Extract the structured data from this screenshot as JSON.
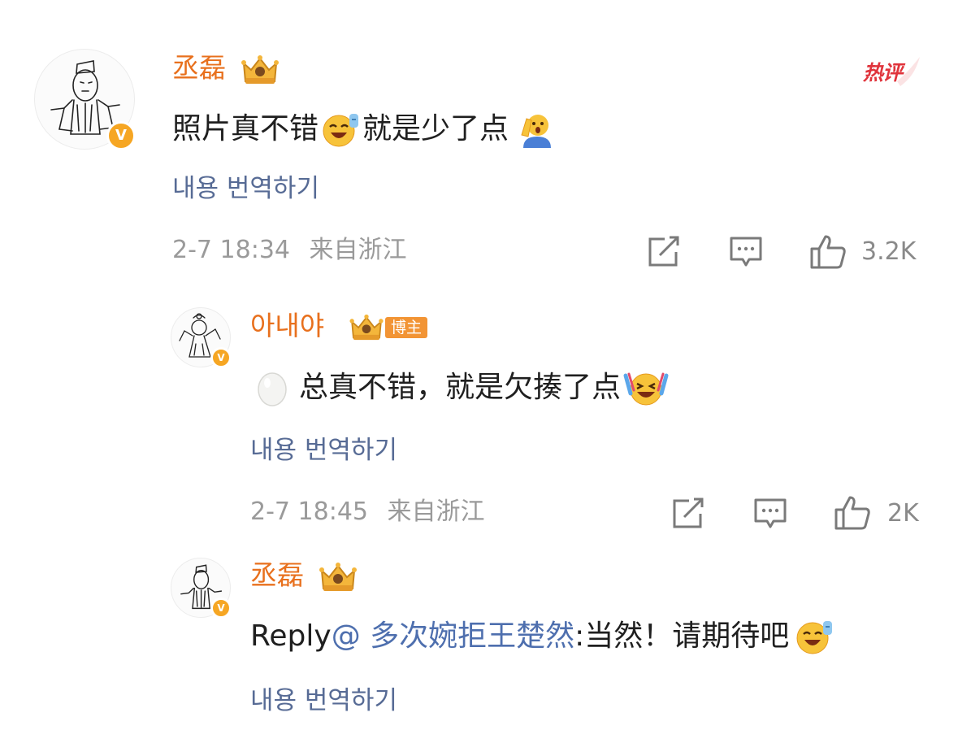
{
  "hot_label": "热评",
  "comments": [
    {
      "username": "丞磊",
      "content_before": "照片真不错",
      "content_after": "就是少了点",
      "translate": "내용 번역하기",
      "time": "2-7 18:34",
      "location": "来自浙江",
      "likes": "3.2K",
      "verified_badge": "V",
      "icons": [
        "crown-badge-icon",
        "grin-sweat-emoji-icon",
        "salute-person-emoji-icon",
        "share-icon",
        "comment-icon",
        "thumbs-up-icon"
      ]
    },
    {
      "username": "아내야",
      "blogger_badge": "博主",
      "content_main": "总真不错，就是欠揍了点",
      "translate": "내용 번역하기",
      "time": "2-7 18:45",
      "location": "来自浙江",
      "likes": "2K",
      "verified_badge": "V",
      "icons": [
        "crown-badge-icon",
        "egg-emoji-icon",
        "laugh-cry-emoji-icon",
        "share-icon",
        "comment-icon",
        "thumbs-up-icon"
      ]
    },
    {
      "username": "丞磊",
      "reply_prefix": "Reply",
      "mention": "@ 多次婉拒王楚然",
      "reply_text": ":当然！请期待吧",
      "translate": "내용 번역하기",
      "verified_badge": "V",
      "icons": [
        "crown-badge-icon",
        "grin-sweat-emoji-icon"
      ]
    }
  ],
  "colors": {
    "username": "#e8701d",
    "translate_link": "#576b95",
    "mention": "#4e6fae",
    "meta": "#9a9a9a",
    "hot": "#e0343c",
    "verified": "#f6a623"
  }
}
